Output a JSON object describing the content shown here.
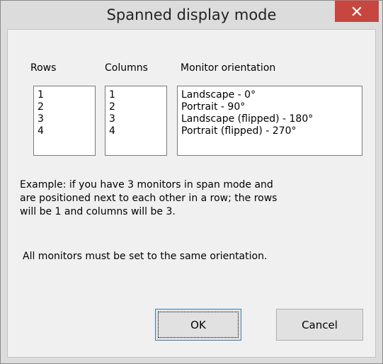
{
  "window": {
    "title": "Spanned display mode"
  },
  "labels": {
    "rows": "Rows",
    "columns": "Columns",
    "orientation": "Monitor orientation"
  },
  "rows": [
    "1",
    "2",
    "3",
    "4"
  ],
  "columns": [
    "1",
    "2",
    "3",
    "4"
  ],
  "orientations": [
    "Landscape - 0°",
    "Portrait - 90°",
    "Landscape (flipped) - 180°",
    "Portrait (flipped) - 270°"
  ],
  "example_lines": [
    "Example: if you have 3 monitors in span mode and",
    "are positioned next to each other in a row; the rows",
    "will be 1 and columns will be 3."
  ],
  "note": "All monitors must be set to the same orientation.",
  "buttons": {
    "ok": "OK",
    "cancel": "Cancel"
  },
  "icons": {
    "close": "close-icon"
  },
  "colors": {
    "close_button": "#c7463f",
    "default_button_border": "#3c7fb1"
  }
}
